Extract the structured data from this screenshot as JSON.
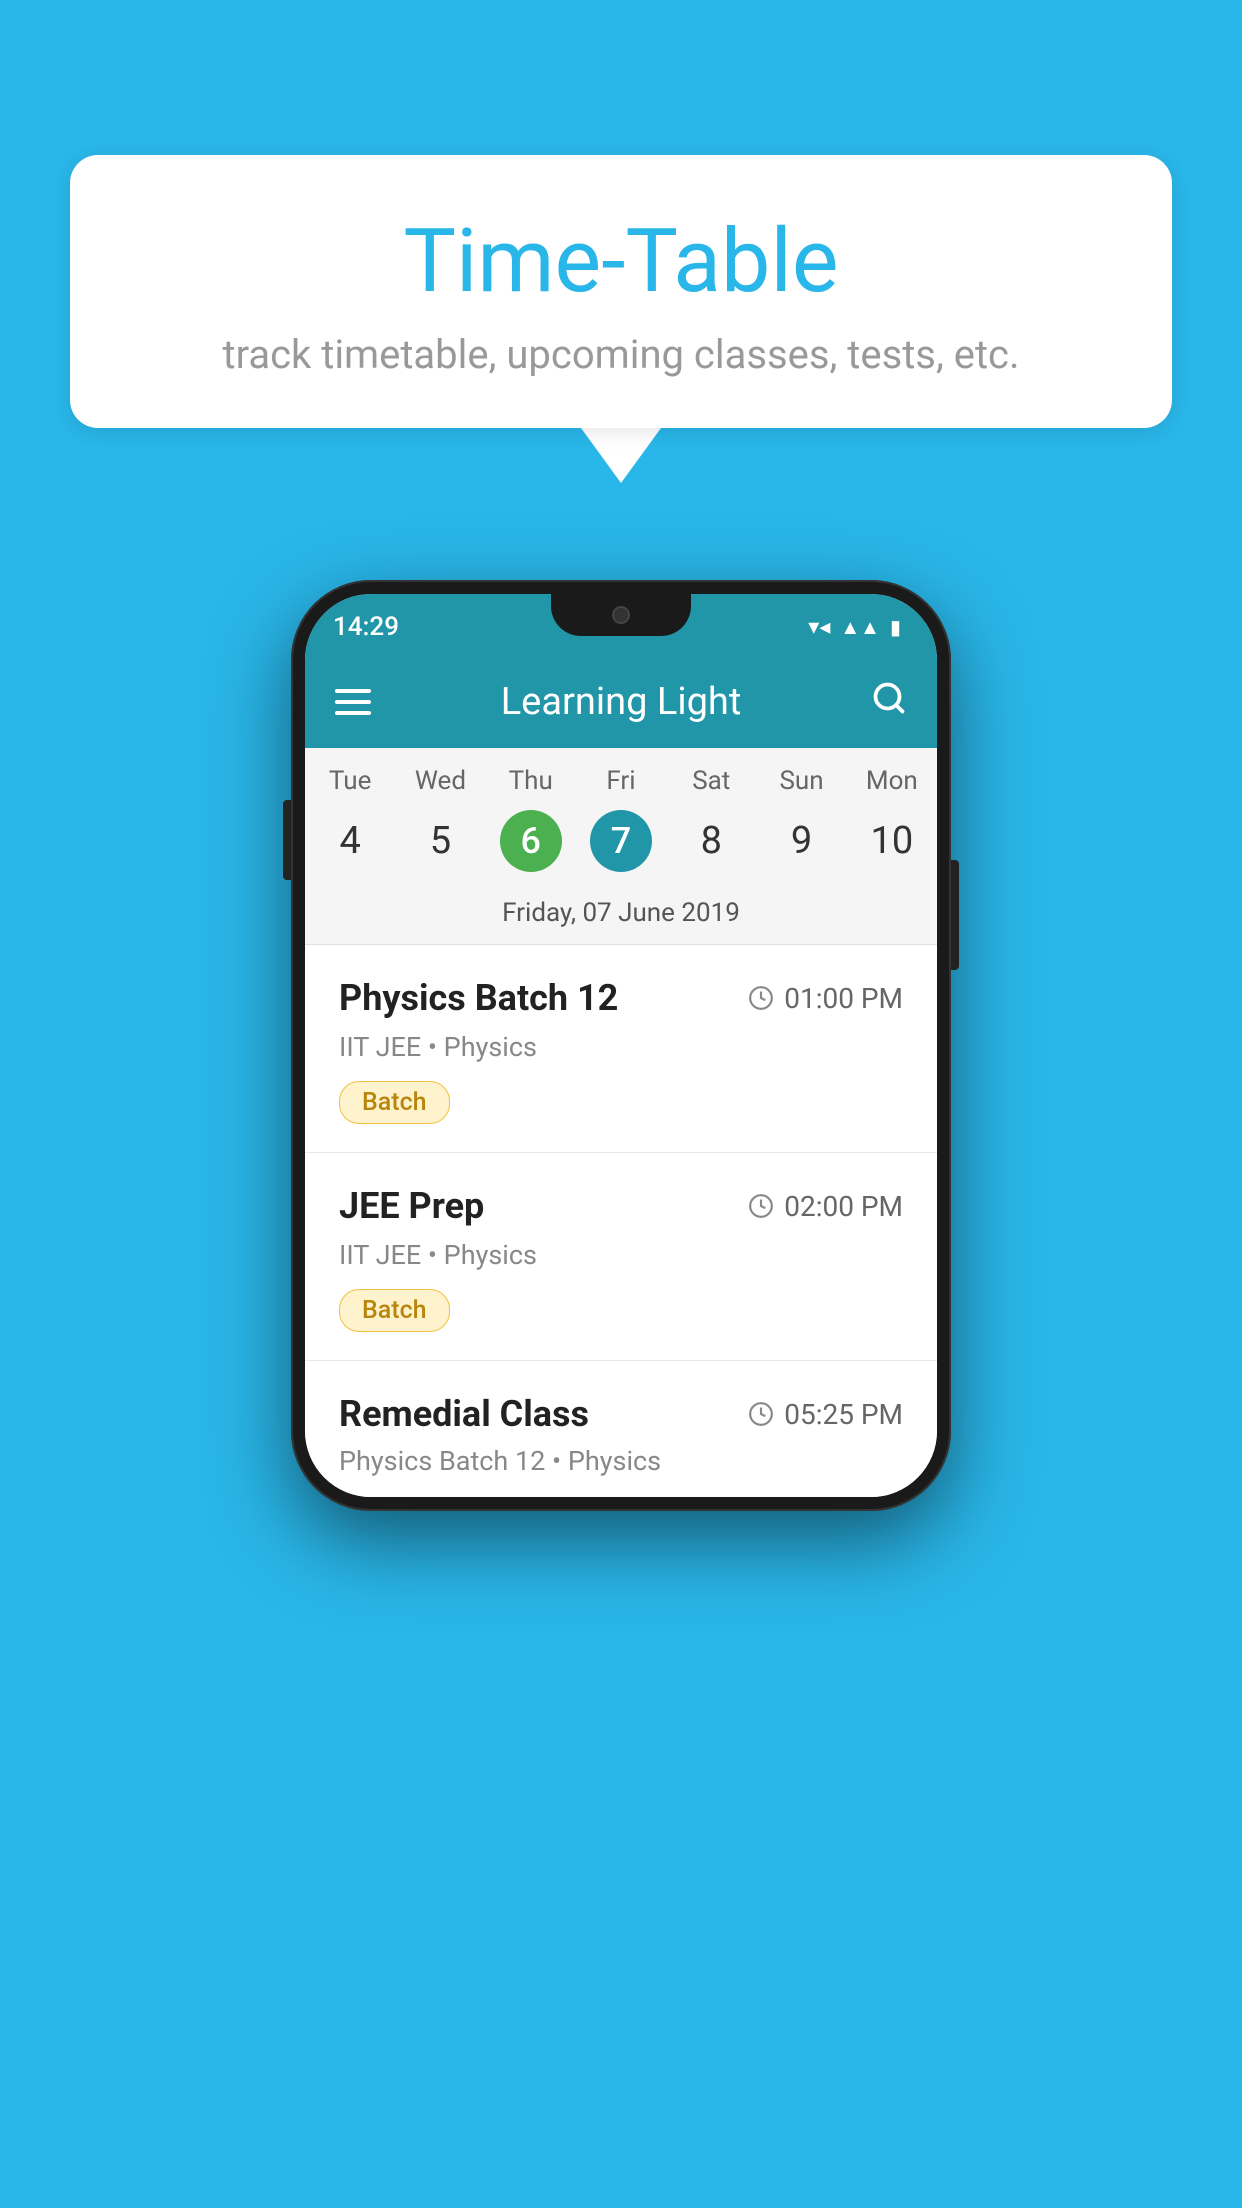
{
  "background": {
    "color": "#29b6e8"
  },
  "speech_bubble": {
    "title": "Time-Table",
    "subtitle": "track timetable, upcoming classes, tests, etc."
  },
  "phone": {
    "status_bar": {
      "time": "14:29"
    },
    "app_bar": {
      "title": "Learning Light"
    },
    "calendar": {
      "days": [
        {
          "name": "Tue",
          "number": "4",
          "state": "normal"
        },
        {
          "name": "Wed",
          "number": "5",
          "state": "normal"
        },
        {
          "name": "Thu",
          "number": "6",
          "state": "today"
        },
        {
          "name": "Fri",
          "number": "7",
          "state": "selected"
        },
        {
          "name": "Sat",
          "number": "8",
          "state": "normal"
        },
        {
          "name": "Sun",
          "number": "9",
          "state": "normal"
        },
        {
          "name": "Mon",
          "number": "10",
          "state": "normal"
        }
      ],
      "selected_date": "Friday, 07 June 2019"
    },
    "classes": [
      {
        "name": "Physics Batch 12",
        "time": "01:00 PM",
        "subtitle": "IIT JEE • Physics",
        "badge": "Batch"
      },
      {
        "name": "JEE Prep",
        "time": "02:00 PM",
        "subtitle": "IIT JEE • Physics",
        "badge": "Batch"
      },
      {
        "name": "Remedial Class",
        "time": "05:25 PM",
        "subtitle": "Physics Batch 12 • Physics",
        "badge": null
      }
    ]
  }
}
